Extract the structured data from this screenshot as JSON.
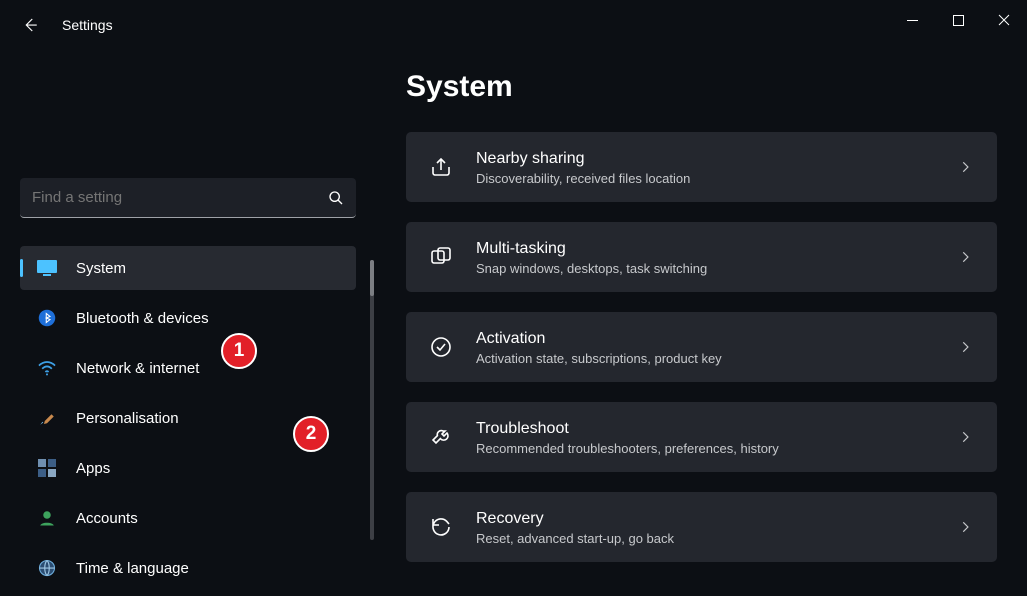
{
  "app": {
    "title": "Settings"
  },
  "search": {
    "placeholder": "Find a setting"
  },
  "page": {
    "title": "System"
  },
  "nav": [
    {
      "label": "System",
      "icon": "monitor",
      "active": true
    },
    {
      "label": "Bluetooth & devices",
      "icon": "bluetooth"
    },
    {
      "label": "Network & internet",
      "icon": "wifi"
    },
    {
      "label": "Personalisation",
      "icon": "brush"
    },
    {
      "label": "Apps",
      "icon": "apps"
    },
    {
      "label": "Accounts",
      "icon": "person"
    },
    {
      "label": "Time & language",
      "icon": "globe"
    }
  ],
  "cards": [
    {
      "title": "Nearby sharing",
      "sub": "Discoverability, received files location",
      "icon": "share"
    },
    {
      "title": "Multi-tasking",
      "sub": "Snap windows, desktops, task switching",
      "icon": "multitask"
    },
    {
      "title": "Activation",
      "sub": "Activation state, subscriptions, product key",
      "icon": "check-circle"
    },
    {
      "title": "Troubleshoot",
      "sub": "Recommended troubleshooters, preferences, history",
      "icon": "wrench"
    },
    {
      "title": "Recovery",
      "sub": "Reset, advanced start-up, go back",
      "icon": "recovery"
    }
  ],
  "annotations": [
    {
      "num": "1"
    },
    {
      "num": "2"
    }
  ]
}
